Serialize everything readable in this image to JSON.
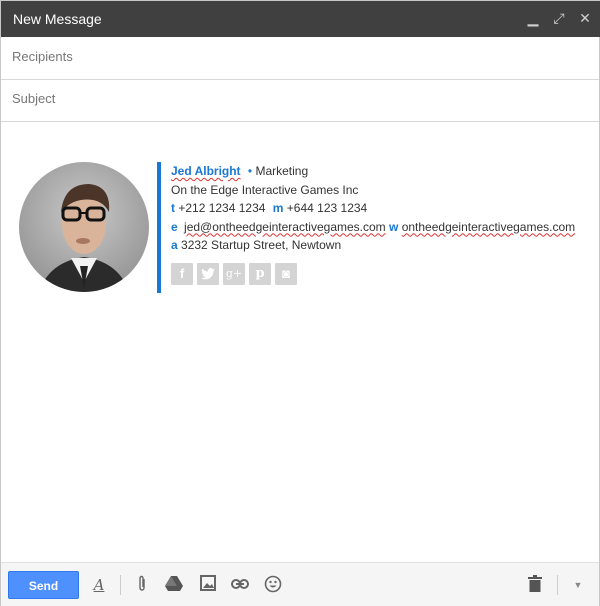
{
  "window": {
    "title": "New Message",
    "controls": {
      "minimize": "minimize-icon",
      "expand": "expand-icon",
      "close": "close-icon"
    }
  },
  "fields": {
    "recipients_placeholder": "Recipients",
    "recipients_value": "",
    "subject_placeholder": "Subject",
    "subject_value": ""
  },
  "signature": {
    "name": "Jed Albright",
    "separator": "•",
    "department": "Marketing",
    "company": "On the Edge Interactive Games Inc",
    "phone_label": "t",
    "phone": "+212 1234 1234",
    "mobile_label": "m",
    "mobile": "+644 123 1234",
    "email_label": "e",
    "email": "jed@ontheedgeinteractivegames.com",
    "web_label": "w",
    "web": "ontheedgeinteractivegames.com",
    "address_label": "a",
    "address": "3232 Startup Street, Newtown",
    "accent_color": "#1a77d2",
    "socials": [
      {
        "name": "facebook",
        "glyph": "f"
      },
      {
        "name": "twitter",
        "glyph": "t"
      },
      {
        "name": "google-plus",
        "glyph": "g+"
      },
      {
        "name": "pinterest",
        "glyph": "p"
      },
      {
        "name": "instagram",
        "glyph": "◙"
      }
    ]
  },
  "toolbar": {
    "send_label": "Send",
    "send_color": "#4d90fe",
    "icons": [
      "format-text-icon",
      "attach-icon",
      "drive-icon",
      "insert-photo-icon",
      "link-icon",
      "emoji-icon",
      "trash-icon",
      "more-options-icon"
    ]
  }
}
